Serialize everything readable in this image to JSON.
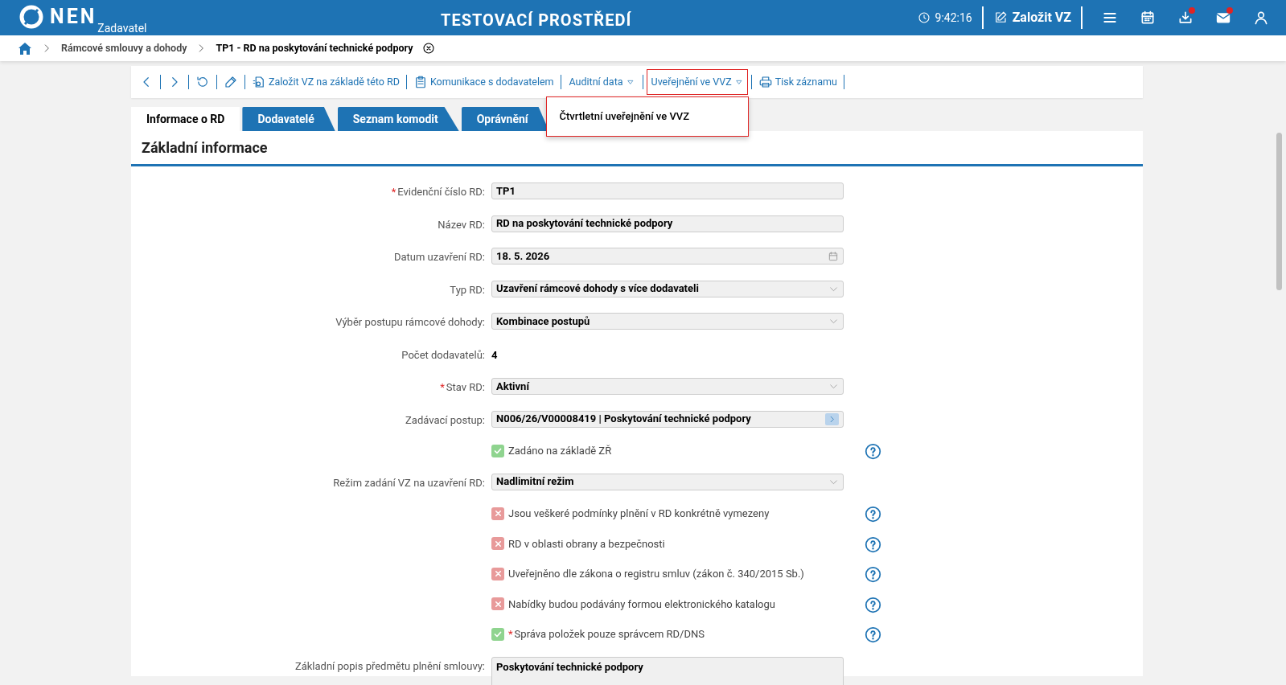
{
  "header": {
    "logo": "NEN",
    "role": "Zadavatel",
    "title": "TESTOVACÍ PROSTŘEDÍ",
    "time": "9:42:16",
    "create_button": "Založit VZ",
    "icons": [
      {
        "kind": "menu"
      },
      {
        "kind": "calendar"
      },
      {
        "kind": "download",
        "badge": true
      },
      {
        "kind": "mail",
        "badge": true
      },
      {
        "kind": "user"
      }
    ]
  },
  "breadcrumb": [
    {
      "label": "Rámcové smlouvy a dohody",
      "current": false
    },
    {
      "label": "TP1 - RD na poskytování technické podpory",
      "current": true
    }
  ],
  "toolbar": [
    {
      "kind": "back"
    },
    {
      "kind": "forward"
    },
    {
      "kind": "refresh"
    },
    {
      "kind": "edit"
    },
    {
      "kind": "create",
      "label": "Založit VZ na základě této RD"
    },
    {
      "kind": "message",
      "label": "Komunikace s dodavatelem"
    },
    {
      "kind": "menu",
      "label": "Auditní data",
      "expanded": false
    },
    {
      "kind": "menu",
      "label": "Uveřejnění ve VVZ",
      "expanded": true,
      "items": [
        "Čtvrtletní uveřejnění ve VVZ"
      ]
    },
    {
      "kind": "print",
      "label": "Tisk záznamu"
    }
  ],
  "tabs": [
    {
      "label": "Informace o RD",
      "selected": true
    },
    {
      "label": "Dodavatelé",
      "selected": false
    },
    {
      "label": "Seznam komodit",
      "selected": false
    },
    {
      "label": "Oprávnění",
      "selected": false
    }
  ],
  "section_title": "Základní informace",
  "fields": [
    {
      "kind": "text",
      "label": "Evidenční číslo RD:",
      "required_mark": "*",
      "value": "TP1"
    },
    {
      "kind": "text",
      "label": "Název RD:",
      "value": "RD na poskytování technické podpory"
    },
    {
      "kind": "date",
      "label": "Datum uzavření RD:",
      "value": "18. 5. 2026"
    },
    {
      "kind": "select",
      "label": "Typ RD:",
      "value": "Uzavření rámcové dohody s více dodavateli"
    },
    {
      "kind": "select",
      "label": "Výběr postupu rámcové dohody:",
      "value": "Kombinace postupů"
    },
    {
      "kind": "plain",
      "label": "Počet dodavatelů:",
      "value": "4"
    },
    {
      "kind": "select",
      "label": "Stav RD:",
      "required_mark": "*",
      "value": "Aktivní"
    },
    {
      "kind": "lookup",
      "label": "Zadávací postup:",
      "value": "N006/26/V00008419 | Poskytování technické podpory"
    },
    {
      "kind": "check",
      "label": "Zadáno na základě ZŘ",
      "checked": true
    },
    {
      "kind": "select",
      "label": "Režim zadání VZ na uzavření RD:",
      "value": "Nadlimitní režim"
    },
    {
      "kind": "check",
      "label": "Jsou veškeré podmínky plnění v RD konkrétně vymezeny",
      "checked": false
    },
    {
      "kind": "check",
      "label": "RD v oblasti obrany a bezpečnosti",
      "checked": false
    },
    {
      "kind": "check",
      "label": "Uveřejněno dle zákona o registru smluv (zákon č. 340/2015 Sb.)",
      "checked": false
    },
    {
      "kind": "check",
      "label": "Nabídky budou podávány formou elektronického katalogu",
      "checked": false
    },
    {
      "kind": "check",
      "label": "Správa položek pouze správcem RD/DNS",
      "required_mark": "*",
      "checked": true
    },
    {
      "kind": "textarea",
      "label": "Základní popis předmětu plnění smlouvy:",
      "value": "Poskytování technické podpory"
    }
  ]
}
